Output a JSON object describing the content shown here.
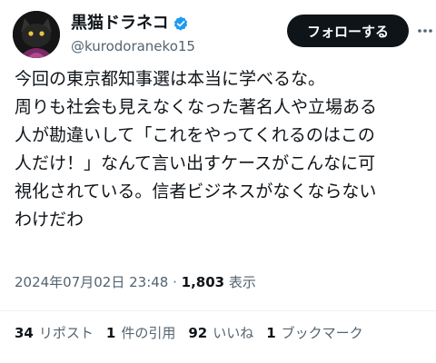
{
  "author": {
    "display_name": "黒猫ドラネコ",
    "handle": "@kurodoraneko15",
    "verified_icon": "verified-badge-icon",
    "verified_color": "#1d9bf0"
  },
  "header": {
    "follow_label": "フォローする",
    "more_icon": "more-options-icon"
  },
  "tweet": {
    "text": "今回の東京都知事選は本当に学べるな。\n周りも社会も見えなくなった著名人や立場ある\n人が勘違いして「これをやってくれるのはこの\n人だけ！」なんて言い出すケースがこんなに可\n視化されている。信者ビジネスがなくならない\nわけだわ",
    "timestamp": "2024年07月02日 23:48",
    "separator": " · ",
    "views_count": "1,803",
    "views_label": " 表示"
  },
  "stats": {
    "reposts_count": "34",
    "reposts_label": "リポスト",
    "quotes_count": "1",
    "quotes_label": "件の引用",
    "likes_count": "92",
    "likes_label": "いいね",
    "bookmarks_count": "1",
    "bookmarks_label": "ブックマーク"
  }
}
